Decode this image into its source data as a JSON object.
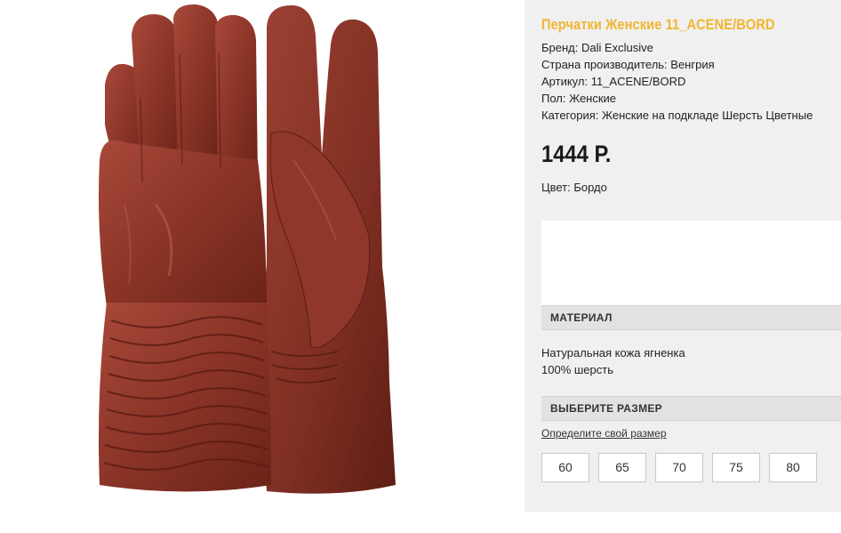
{
  "product": {
    "title": "Перчатки Женские 11_ACENE/BORD",
    "specs": [
      "Бренд: Dali Exclusive",
      "Страна производитель: Венгрия",
      "Артикул: 11_ACENE/BORD",
      "Пол: Женские",
      "Категория: Женские на подкладе Шерсть Цветные"
    ],
    "price": "1444 Р.",
    "color": "Цвет: Бордо",
    "accent_color": "#f1b530",
    "image_color": "#8e3a2d"
  },
  "material": {
    "header": "МАТЕРИАЛ",
    "lines": [
      "Натуральная кожа ягненка",
      "100% шерсть"
    ]
  },
  "size": {
    "header": "ВЫБЕРИТЕ РАЗМЕР",
    "link": "Определите свой размер",
    "options": [
      "60",
      "65",
      "70",
      "75",
      "80"
    ]
  }
}
